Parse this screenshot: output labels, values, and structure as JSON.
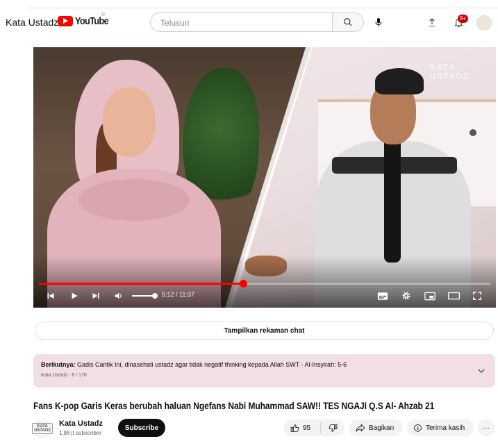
{
  "header": {
    "channel_label": "Kata Ustadz",
    "logo_text": "YouTube",
    "logo_mark": "©",
    "search_placeholder": "Telusuri",
    "notification_count": "9+"
  },
  "player": {
    "watermark_line1": "KATA",
    "watermark_line2": "USTADZ",
    "progress_fraction": 0.452,
    "volume_fraction": 1.0,
    "time_display": "5:12 / 11:37"
  },
  "chat": {
    "label": "Tampilkan rekaman chat"
  },
  "up_next": {
    "prefix": "Berikutnya:",
    "title": "Gadis Cantik Ini, dinasehati ustadz agar tidak negatif thinking kepada Allah SWT - Al-Insyirah: 5-6",
    "playlist_info": "Kata Ustadz - 6 / 178"
  },
  "video": {
    "title": "Fans K-pop Garis Keras berubah haluan Ngefans Nabi Muhammad SAW!! TES NGAJI Q.S Al- Ahzab 21"
  },
  "channel": {
    "name": "Kata Ustadz",
    "subscribers": "1,88 jt subscriber",
    "avatar_text_1": "KATA",
    "avatar_text_2": "USTADZ",
    "subscribe_label": "Subscribe"
  },
  "actions": {
    "like_count": "95",
    "share_label": "Bagikan",
    "thanks_label": "Terima kasih",
    "more_label": "···"
  },
  "colors": {
    "accent_red": "#ff0000",
    "up_next_bg": "#f2dfe4",
    "subscribe_bg": "#0f0f0f"
  }
}
